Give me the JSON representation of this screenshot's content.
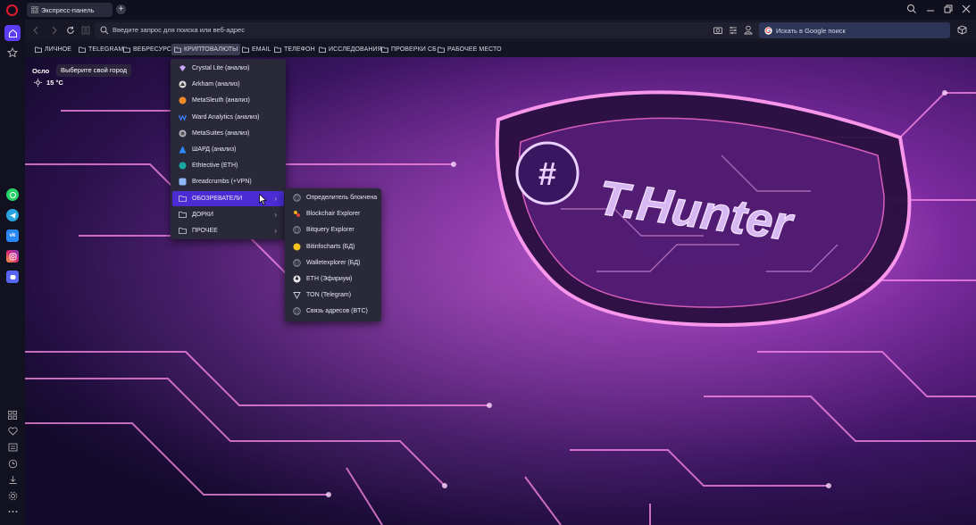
{
  "tab": {
    "title": "Экспресс-панель"
  },
  "address": {
    "placeholder": "Введите запрос для поиска или веб-адрес"
  },
  "google": {
    "placeholder": "Искать в Google поиск"
  },
  "bookmarks": [
    "ЛИЧНОЕ",
    "TELEGRAM",
    "ВЕБРЕСУРСЫ",
    "КРИПТОВАЛЮТЫ",
    "EMAIL",
    "ТЕЛЕФОН",
    "ИССЛЕДОВАНИЯ",
    "ПРОВЕРКИ СБ",
    "РАБОЧЕЕ МЕСТО"
  ],
  "weather": {
    "city": "Осло",
    "choose_city": "Выберите свой город",
    "temperature": "15 °C"
  },
  "crypto_menu": [
    {
      "label": "Crystal Lite (анализ)",
      "icon": "crystal-icon"
    },
    {
      "label": "Arkham (анализ)",
      "icon": "arkham-icon"
    },
    {
      "label": "MetaSleuth (анализ)",
      "icon": "metasleuth-icon"
    },
    {
      "label": "Ward Analytics (анализ)",
      "icon": "ward-icon"
    },
    {
      "label": "MetaSuites (анализ)",
      "icon": "metasuites-icon"
    },
    {
      "label": "ШАРД (анализ)",
      "icon": "shard-icon"
    },
    {
      "label": "Ethtective (ETH)",
      "icon": "ethtective-icon"
    },
    {
      "label": "Breadcrumbs (+VPN)",
      "icon": "breadcrumbs-icon"
    },
    {
      "label": "ОБОЗРЕВАТЕЛИ",
      "icon": "folder-icon",
      "submenu": true,
      "highlighted": true
    },
    {
      "label": "ДОРКИ",
      "icon": "folder-icon",
      "submenu": true
    },
    {
      "label": "ПРОЧЕЕ",
      "icon": "folder-icon",
      "submenu": true
    }
  ],
  "explorers_menu": [
    {
      "label": "Определитель блокчена",
      "icon": "globe-icon"
    },
    {
      "label": "Blockchair Explorer",
      "icon": "blockchair-icon"
    },
    {
      "label": "Bitquery Explorer",
      "icon": "globe-icon"
    },
    {
      "label": "Bitinfocharts (БД)",
      "icon": "bitinfocharts-icon"
    },
    {
      "label": "Walletexplorer (БД)",
      "icon": "globe-icon"
    },
    {
      "label": "ETH (Эфириум)",
      "icon": "eth-icon"
    },
    {
      "label": "TON (Telegram)",
      "icon": "ton-icon"
    },
    {
      "label": "Связь адресов (BTC)",
      "icon": "globe-icon"
    }
  ],
  "background_logo": {
    "text": "T.Hunter"
  },
  "colors": {
    "accent": "#4a2bd4",
    "sidebar_home": "#5b3df5",
    "opera_red": "#e01b2d"
  }
}
